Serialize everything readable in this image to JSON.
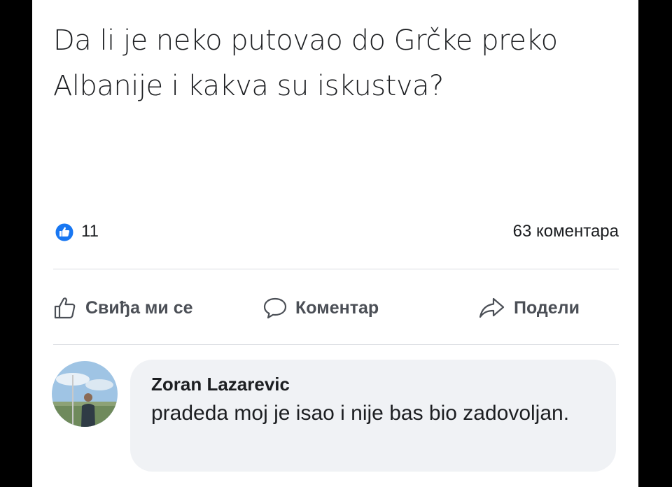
{
  "post": {
    "text": "Da li je neko putovao do Grčke preko Albanije i kakva su iskustva?"
  },
  "reactions": {
    "like_count": "11",
    "comments_count": "63 коментара"
  },
  "actions": {
    "like_label": "Свиђа ми се",
    "comment_label": "Коментар",
    "share_label": "Подели"
  },
  "comment": {
    "author": "Zoran Lazarevic",
    "text": "pradeda moj je isao i nije bas bio zadovoljan."
  },
  "colors": {
    "like_blue": "#1877f2",
    "icon_gray": "#4b4f56"
  }
}
